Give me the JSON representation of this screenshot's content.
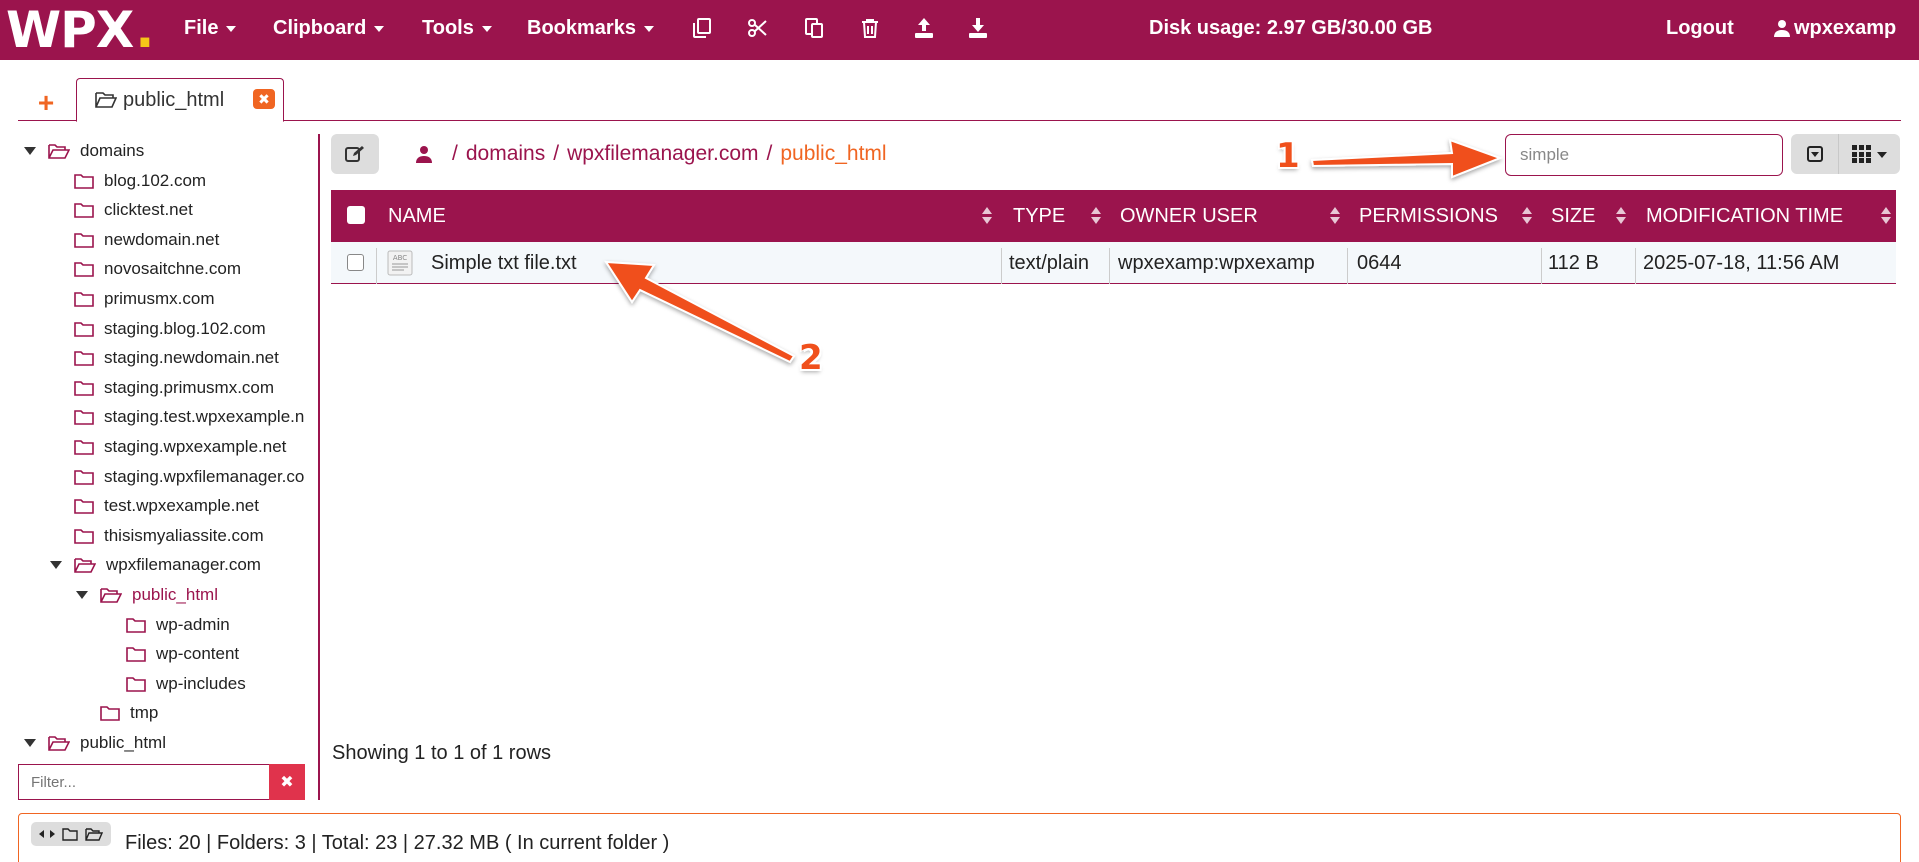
{
  "brand": {
    "logo_text": "WPX",
    "logo_dot": ".",
    "primary": "#9b144d",
    "accent": "#f06522",
    "dot_color": "#f5c518"
  },
  "topbar": {
    "menus": [
      {
        "label": "File",
        "icon": "chevron-down-icon"
      },
      {
        "label": "Clipboard",
        "icon": "chevron-down-icon"
      },
      {
        "label": "Tools",
        "icon": "chevron-down-icon"
      },
      {
        "label": "Bookmarks",
        "icon": "chevron-down-icon"
      }
    ],
    "tools": [
      "copy-icon",
      "cut-icon",
      "paste-icon",
      "trash-icon",
      "upload-icon",
      "download-icon"
    ],
    "disk_usage": "Disk usage: 2.97 GB/30.00 GB",
    "logout": "Logout",
    "username": "wpxexamp"
  },
  "tabs": [
    {
      "label": "public_html",
      "icon": "folder-open-icon"
    }
  ],
  "tree": {
    "items": [
      {
        "label": "domains",
        "expanded": true,
        "level": 0
      },
      {
        "label": "blog.102.com",
        "level": 1
      },
      {
        "label": "clicktest.net",
        "level": 1
      },
      {
        "label": "newdomain.net",
        "level": 1
      },
      {
        "label": "novosaitchne.com",
        "level": 1
      },
      {
        "label": "primusmx.com",
        "level": 1
      },
      {
        "label": "staging.blog.102.com",
        "level": 1
      },
      {
        "label": "staging.newdomain.net",
        "level": 1
      },
      {
        "label": "staging.primusmx.com",
        "level": 1
      },
      {
        "label": "staging.test.wpxexample.net",
        "level": 1
      },
      {
        "label": "staging.wpxexample.net",
        "level": 1
      },
      {
        "label": "staging.wpxfilemanager.com",
        "level": 1
      },
      {
        "label": "test.wpxexample.net",
        "level": 1
      },
      {
        "label": "thisismyaliassite.com",
        "level": 1
      },
      {
        "label": "wpxfilemanager.com",
        "expanded": true,
        "level": 1
      },
      {
        "label": "public_html",
        "expanded": true,
        "active": true,
        "level": 2
      },
      {
        "label": "wp-admin",
        "level": 3
      },
      {
        "label": "wp-content",
        "level": 3
      },
      {
        "label": "wp-includes",
        "level": 3
      },
      {
        "label": "tmp",
        "level": 2
      },
      {
        "label": "public_html",
        "expanded": true,
        "level": 0
      }
    ],
    "filter_placeholder": "Filter..."
  },
  "breadcrumb": {
    "parts": [
      "domains",
      "wpxfilemanager.com"
    ],
    "separator": "/",
    "current": "public_html"
  },
  "search": {
    "value": "simple"
  },
  "table": {
    "columns": [
      "NAME",
      "TYPE",
      "OWNER USER",
      "PERMISSIONS",
      "SIZE",
      "MODIFICATION TIME"
    ],
    "rows": [
      {
        "name": "Simple txt file.txt",
        "type": "text/plain",
        "owner": "wpxexamp:wpxexamp",
        "permissions": "0644",
        "size": "112 B",
        "modified": "2025-07-18, 11:56 AM"
      }
    ],
    "showing": "Showing 1 to 1 of 1 rows"
  },
  "footer": {
    "summary": "Files: 20 | Folders: 3 | Total: 23 | 27.32 MB ( In current folder )"
  },
  "annotations": {
    "label_1": "1",
    "label_2": "2",
    "color": "#f0501c"
  }
}
